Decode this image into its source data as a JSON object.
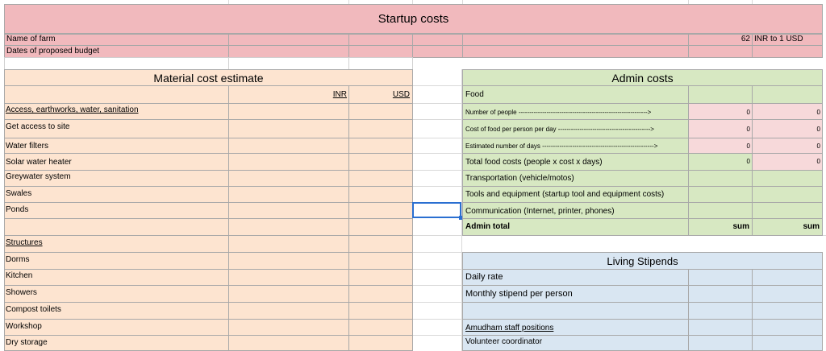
{
  "sheet": {
    "title": "Startup costs",
    "name_of_farm_label": "Name of farm",
    "dates_label": "Dates of proposed budget",
    "exchange_rate": "62",
    "exchange_label": "INR to 1 USD"
  },
  "material": {
    "title": "Material cost estimate",
    "col_inr": "INR",
    "col_usd": "USD",
    "section_access": "Access, earthworks, water, sanitation",
    "items_access": [
      "Get access to site",
      "Water filters",
      "Solar water heater",
      "Greywater system",
      "Swales",
      "Ponds"
    ],
    "section_structures": "Structures",
    "items_structures": [
      "Dorms",
      "Kitchen",
      "Showers",
      "Compost toilets",
      "Workshop",
      "Dry storage"
    ]
  },
  "admin": {
    "title": "Admin costs",
    "food_label": "Food",
    "num_people": "Number of people ------------------------------------------------------------>",
    "cost_food": "Cost of food per person per day ------------------------------------------->",
    "est_days": "Estimated number of days ---------------------------------------------------->",
    "total_food": "Total food costs (people x cost x days)",
    "transportation": "Transportation (vehicle/motos)",
    "tools": "Tools and equipment (startup tool and equipment costs)",
    "communication": "Communication (Internet, printer, phones)",
    "total_label": "Admin total",
    "zero": "0",
    "sum": "sum"
  },
  "stipends": {
    "title": "Living Stipends",
    "daily_rate": "Daily rate",
    "monthly": "Monthly stipend per person",
    "staff_positions": "Amudham staff positions",
    "volunteer": "Volunteer coordinator"
  }
}
